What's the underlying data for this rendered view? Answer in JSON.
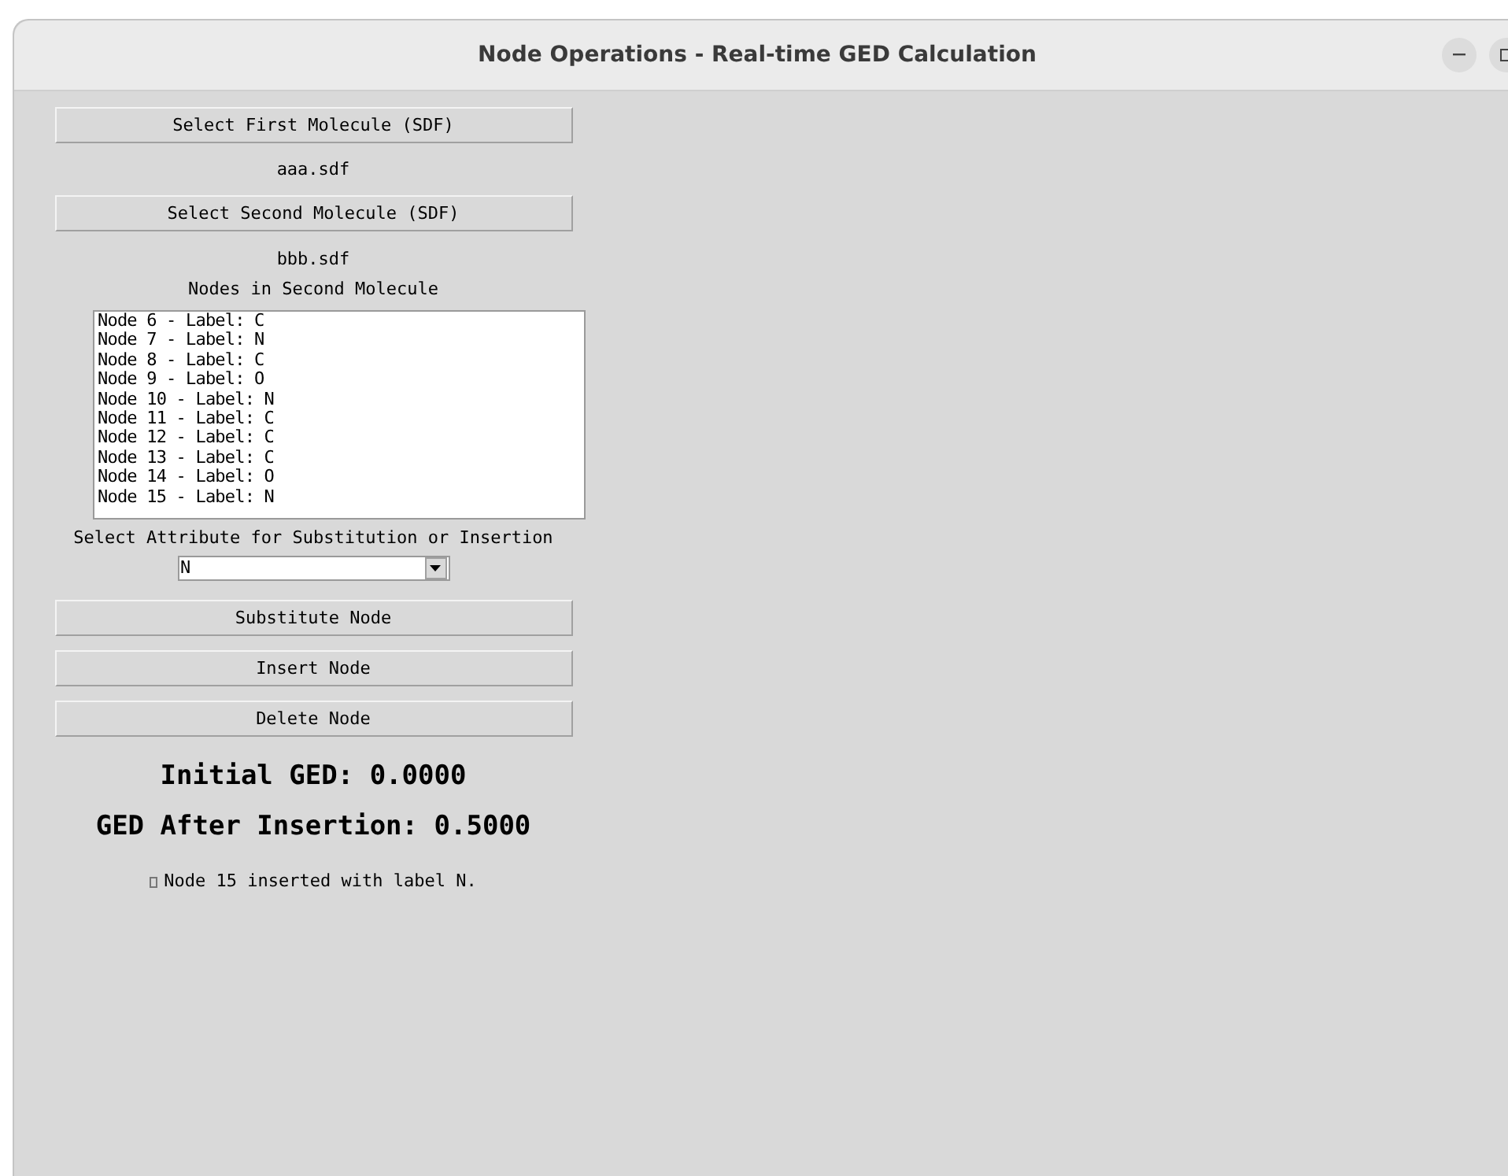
{
  "window": {
    "title": "Node Operations - Real-time GED Calculation"
  },
  "first_button": "Select First Molecule (SDF)",
  "first_file": "aaa.sdf",
  "second_button": "Select Second Molecule (SDF)",
  "second_file": "bbb.sdf",
  "nodes_heading": "Nodes in Second Molecule",
  "nodes": [
    "Node 6 - Label: C",
    "Node 7 - Label: N",
    "Node 8 - Label: C",
    "Node 9 - Label: O",
    "Node 10 - Label: N",
    "Node 11 - Label: C",
    "Node 12 - Label: C",
    "Node 13 - Label: C",
    "Node 14 - Label: O",
    "Node 15 - Label: N"
  ],
  "attribute_label": "Select Attribute for Substitution or Insertion",
  "attribute_select": {
    "value": "N"
  },
  "action_buttons": [
    "Substitute Node",
    "Insert Node",
    "Delete Node"
  ],
  "initial_ged": "Initial GED: 0.0000",
  "ged_after": "GED After Insertion: 0.5000",
  "status_message": "Node 15 inserted with label N."
}
